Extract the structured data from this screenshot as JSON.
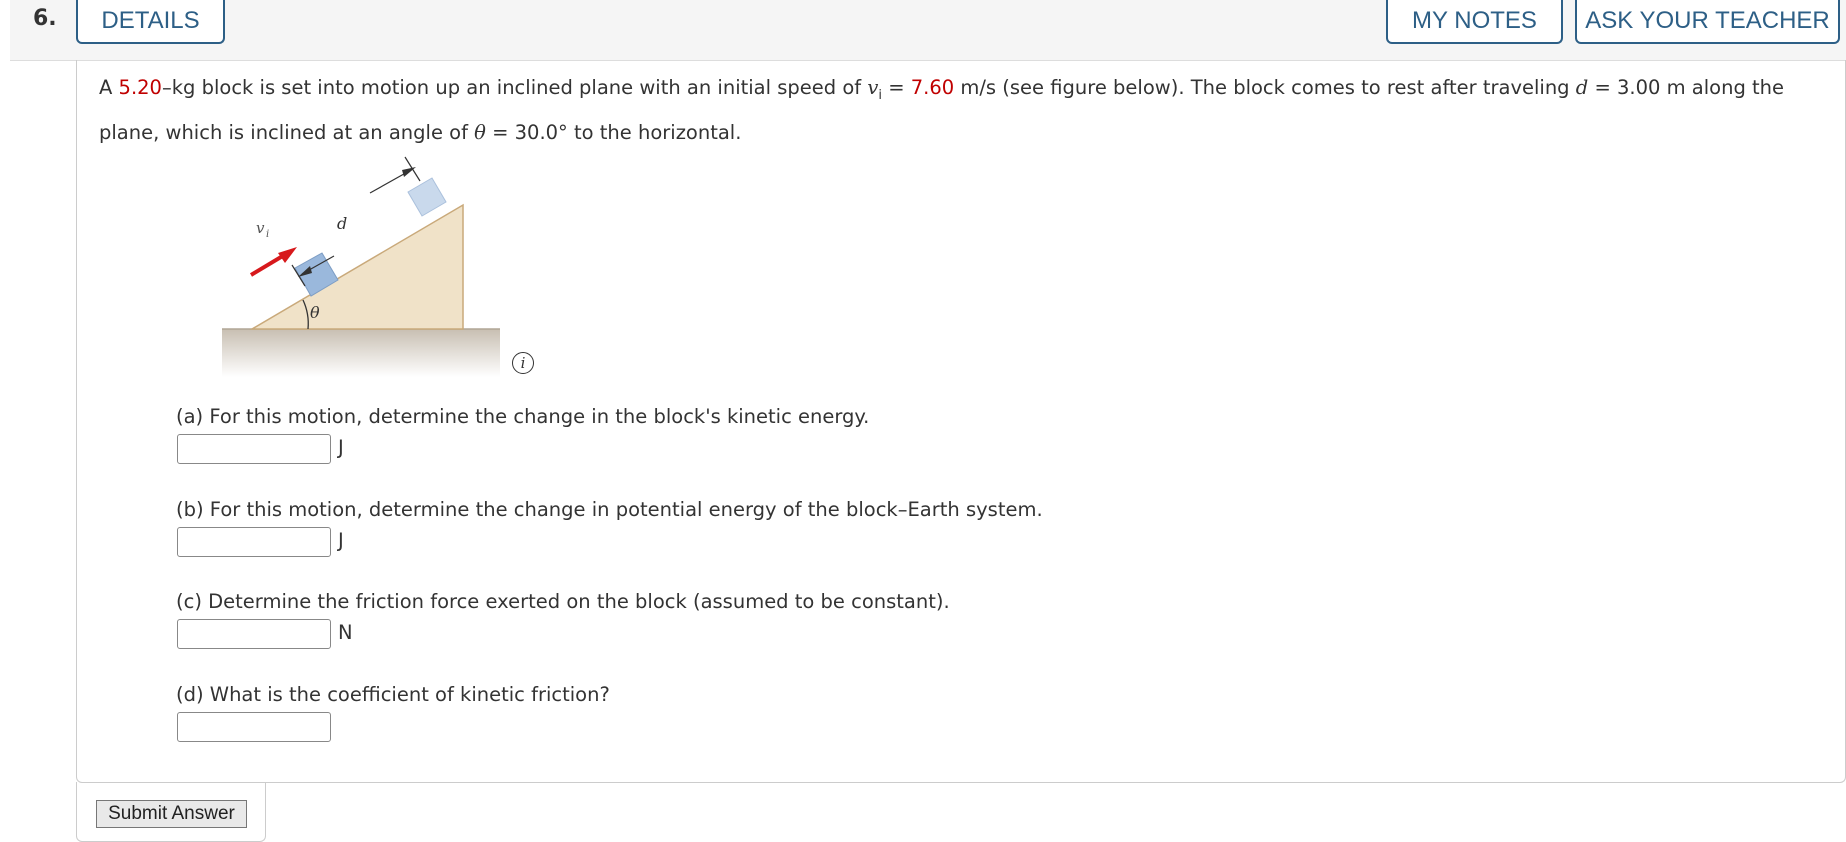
{
  "header": {
    "question_number": "6.",
    "details_label": "DETAILS",
    "my_notes_label": "MY NOTES",
    "ask_teacher_label": "ASK YOUR TEACHER"
  },
  "problem": {
    "t1": "A ",
    "mass": "5.20",
    "t2": "–kg block is set into motion up an inclined plane with an initial speed of ",
    "v_sym": "v",
    "v_sub": "i",
    "t3": " = ",
    "speed": "7.60",
    "t4": " m/s (see figure below). The block comes to rest after traveling ",
    "d_sym": "d",
    "t5": " = 3.00 m along the plane, which is inclined at an angle of ",
    "theta_sym": "θ",
    "t6": " = 30.0° to the horizontal."
  },
  "figure": {
    "vi_label": "v",
    "vi_sub": "i",
    "d_label": "d",
    "theta_label": "θ",
    "info_icon": "i"
  },
  "parts": [
    {
      "label": "(a) For this motion, determine the change in the block's kinetic energy.",
      "value": "",
      "unit": "J"
    },
    {
      "label": "(b) For this motion, determine the change in potential energy of the block–Earth system.",
      "value": "",
      "unit": "J"
    },
    {
      "label": "(c) Determine the friction force exerted on the block (assumed to be constant).",
      "value": "",
      "unit": "N"
    },
    {
      "label": "(d) What is the coefficient of kinetic friction?",
      "value": "",
      "unit": ""
    }
  ],
  "submit_label": "Submit Answer",
  "colors": {
    "accent": "#2d5f86",
    "highlight": "#c00000",
    "incline_fill": "#f0e2c8",
    "block_near": "#9ab8dc",
    "block_far": "#c9d9ec",
    "arrow": "#d7191c"
  }
}
